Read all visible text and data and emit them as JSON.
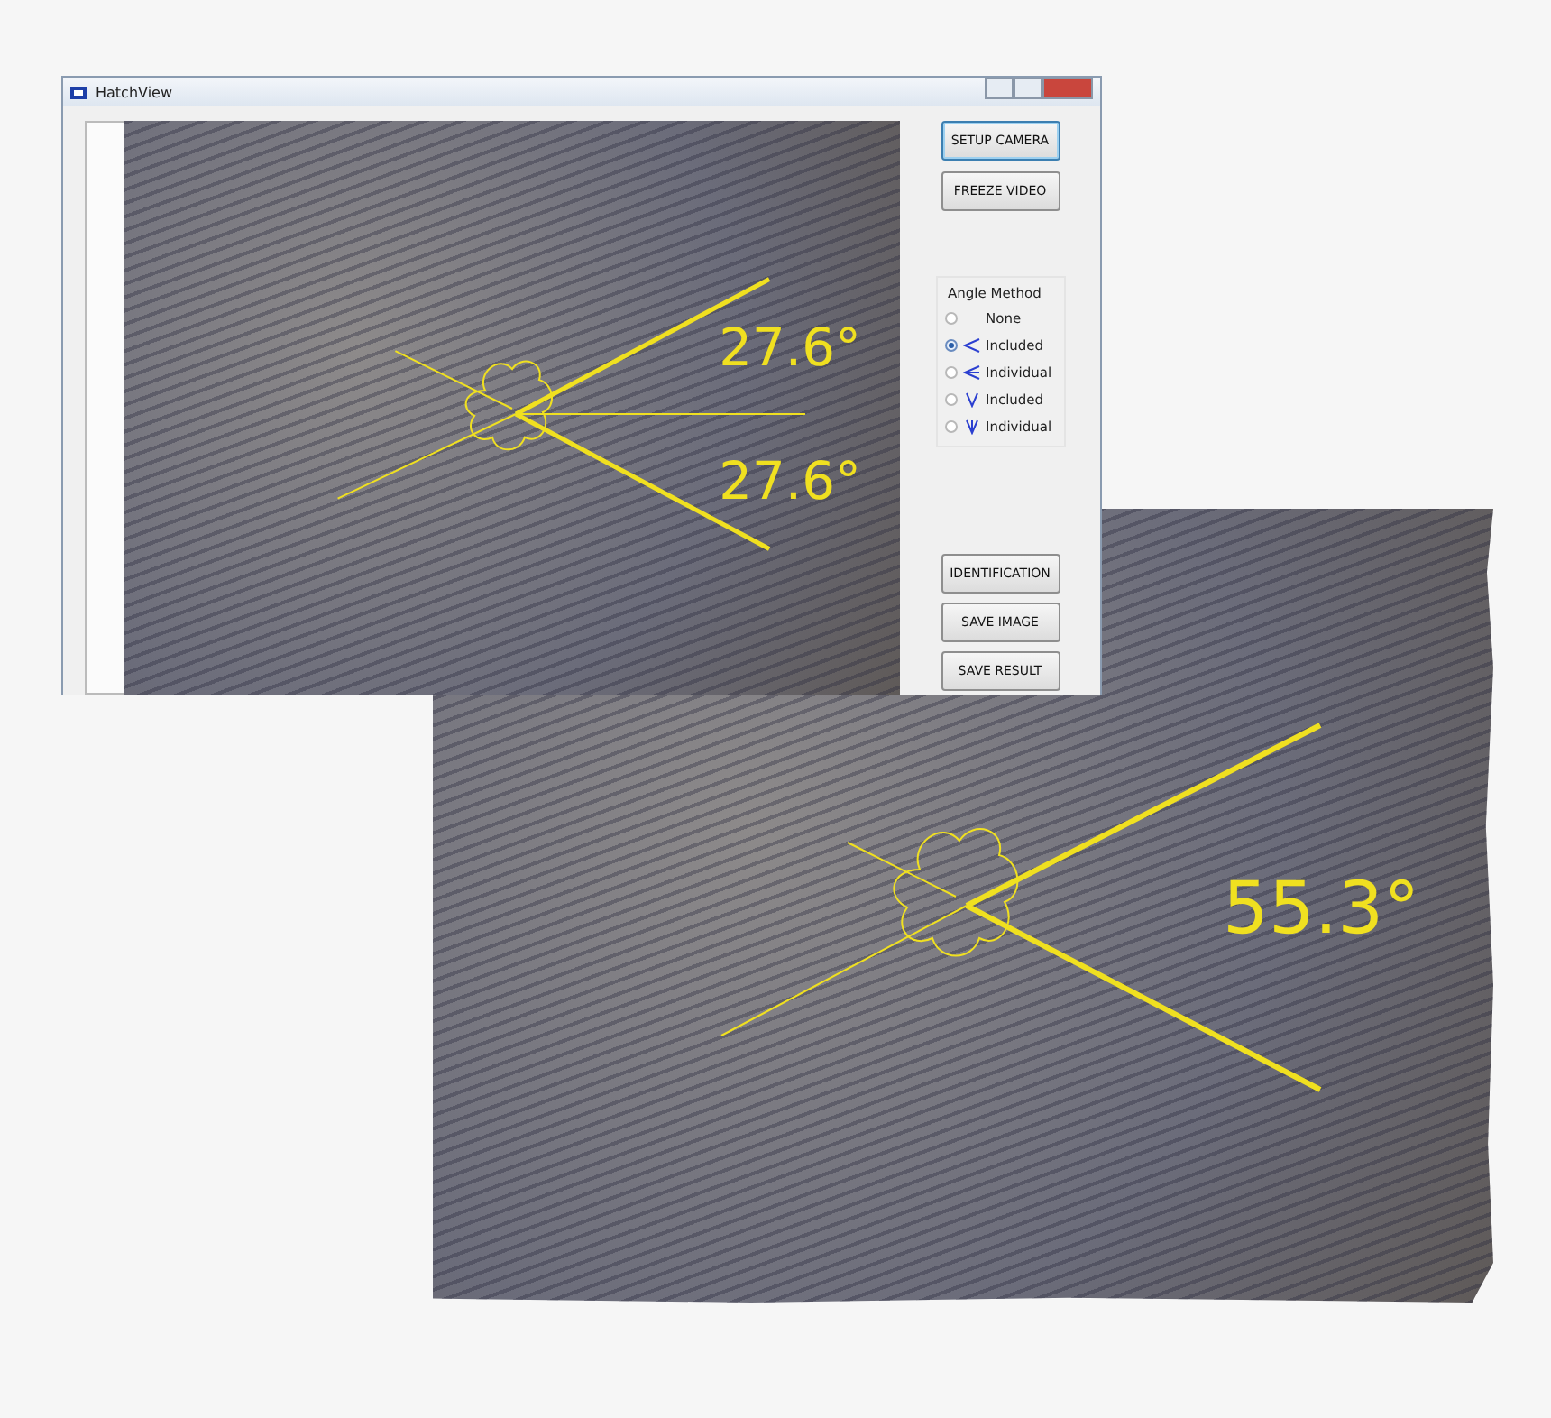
{
  "window": {
    "title": "HatchView"
  },
  "video": {
    "measurements": [
      "27.6°",
      "27.6°"
    ]
  },
  "buttons_top": [
    "SETUP CAMERA",
    "FREEZE VIDEO"
  ],
  "angle_method": {
    "title": "Angle Method",
    "options": [
      {
        "label": "None",
        "kind": "none",
        "selected": false
      },
      {
        "label": "Included",
        "kind": "h-included",
        "selected": true
      },
      {
        "label": "Individual",
        "kind": "h-individual",
        "selected": false
      },
      {
        "label": "Included",
        "kind": "v-included",
        "selected": false
      },
      {
        "label": "Individual",
        "kind": "v-individual",
        "selected": false
      }
    ]
  },
  "buttons_bottom": [
    "IDENTIFICATION",
    "SAVE IMAGE",
    "SAVE RESULT"
  ],
  "zoomed_view": {
    "measurement": "55.3°"
  }
}
